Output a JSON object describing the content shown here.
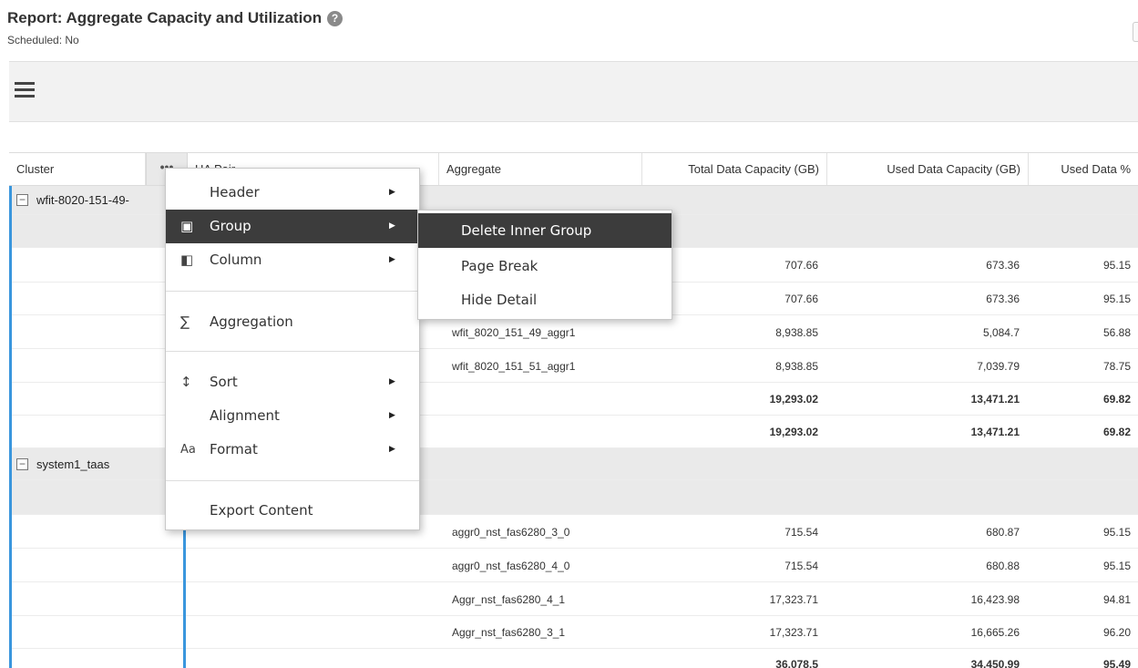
{
  "report": {
    "title": "Report: Aggregate Capacity and Utilization",
    "help_glyph": "?",
    "schedule": "Scheduled: No"
  },
  "table": {
    "columns": [
      "Cluster",
      "HA Pair",
      "Aggregate",
      "Total Data Capacity (GB)",
      "Used Data Capacity (GB)",
      "Used Data %"
    ],
    "column_more_glyph": "•••",
    "groups": [
      {
        "cluster": "wfit-8020-151-49-",
        "rows": [
          {
            "aggregate": "",
            "total": "707.66",
            "used": "673.36",
            "pct": "95.15"
          },
          {
            "aggregate": "",
            "total": "707.66",
            "used": "673.36",
            "pct": "95.15"
          },
          {
            "aggregate": "wfit_8020_151_49_aggr1",
            "total": "8,938.85",
            "used": "5,084.7",
            "pct": "56.88"
          },
          {
            "aggregate": "wfit_8020_151_51_aggr1",
            "total": "8,938.85",
            "used": "7,039.79",
            "pct": "78.75"
          }
        ],
        "subtotals": [
          {
            "total": "19,293.02",
            "used": "13,471.21",
            "pct": "69.82"
          },
          {
            "total": "19,293.02",
            "used": "13,471.21",
            "pct": "69.82"
          }
        ]
      },
      {
        "cluster": "system1_taas",
        "rows": [
          {
            "aggregate": "aggr0_nst_fas6280_3_0",
            "total": "715.54",
            "used": "680.87",
            "pct": "95.15"
          },
          {
            "aggregate": "aggr0_nst_fas6280_4_0",
            "total": "715.54",
            "used": "680.88",
            "pct": "95.15"
          },
          {
            "aggregate": "Aggr_nst_fas6280_4_1",
            "total": "17,323.71",
            "used": "16,423.98",
            "pct": "94.81"
          },
          {
            "aggregate": "Aggr_nst_fas6280_3_1",
            "total": "17,323.71",
            "used": "16,665.26",
            "pct": "96.20"
          }
        ],
        "partial_total": {
          "total": "36,078.5",
          "used": "34,450.99",
          "pct": "95.49"
        }
      }
    ]
  },
  "context_menu": {
    "items": [
      {
        "label": "Header",
        "icon": "",
        "submenu": true
      },
      {
        "label": "Group",
        "icon": "group-icon",
        "submenu": true,
        "active": true
      },
      {
        "label": "Column",
        "icon": "column-icon",
        "submenu": true
      },
      {
        "label": "Aggregation",
        "icon": "sigma-icon",
        "submenu": false
      },
      {
        "label": "Sort",
        "icon": "sort-icon",
        "submenu": true
      },
      {
        "label": "Alignment",
        "icon": "",
        "submenu": true
      },
      {
        "label": "Format",
        "icon": "format-icon",
        "submenu": true
      },
      {
        "label": "Export Content",
        "icon": "",
        "submenu": false
      }
    ],
    "icon_glyphs": {
      "group": "▣",
      "column": "◧",
      "sigma": "∑",
      "sort": "↕",
      "format": "Aa"
    },
    "arrow_glyph": "▶"
  },
  "group_submenu": {
    "items": [
      "Delete Inner Group",
      "Page Break",
      "Hide Detail"
    ]
  },
  "colors": {
    "selection": "#3a96dd",
    "menu_active": "#3c3c3c"
  }
}
